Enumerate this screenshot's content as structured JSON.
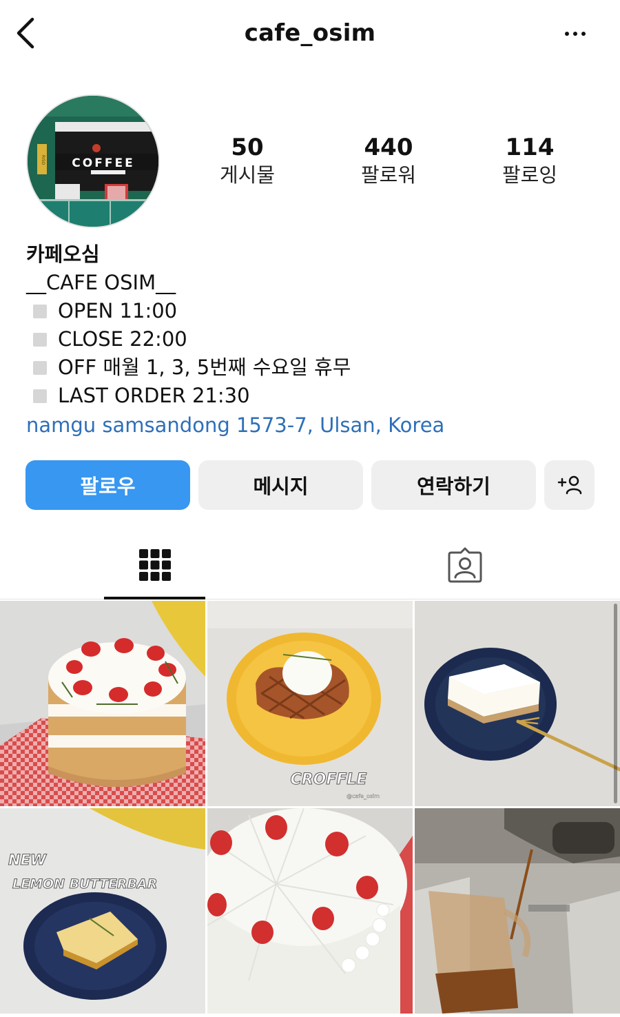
{
  "header": {
    "title": "cafe_osim",
    "back_icon": "chevron-left-icon",
    "more_icon": "more-horizontal-icon"
  },
  "profile": {
    "avatar_sign_text": "COFFEE",
    "avatar_side_text": "RISO",
    "stats": [
      {
        "num": "50",
        "label": "게시물"
      },
      {
        "num": "440",
        "label": "팔로워"
      },
      {
        "num": "114",
        "label": "팔로잉"
      }
    ]
  },
  "bio": {
    "name": "카페오심",
    "tagline": "__CAFE OSIM__",
    "lines": [
      "OPEN 11:00",
      "CLOSE 22:00",
      "OFF 매월 1, 3, 5번째 수요일 휴무",
      "LAST ORDER 21:30"
    ],
    "location": "namgu samsandong 1573-7, Ulsan, Korea"
  },
  "buttons": {
    "follow": "팔로우",
    "message": "메시지",
    "contact": "연락하기",
    "add_user_icon": "add-user-icon"
  },
  "tabs": {
    "grid_icon": "grid-icon",
    "tagged_icon": "tagged-person-icon",
    "active": "grid"
  },
  "posts": [
    {
      "subject": "strawberry layer cake"
    },
    {
      "subject": "croffle with ice cream",
      "overlay": "CROFFLE",
      "watermark": "@cafe_osim"
    },
    {
      "subject": "cheesecake slice"
    },
    {
      "subject": "lemon butter bar",
      "overlay_line1": "NEW",
      "overlay_line2": "LEMON BUTTERBAR"
    },
    {
      "subject": "strawberry cream cake"
    },
    {
      "subject": "espresso extraction"
    }
  ],
  "colors": {
    "accent": "#3897f0",
    "link": "#2e6fb8",
    "button_bg": "#efefef"
  }
}
